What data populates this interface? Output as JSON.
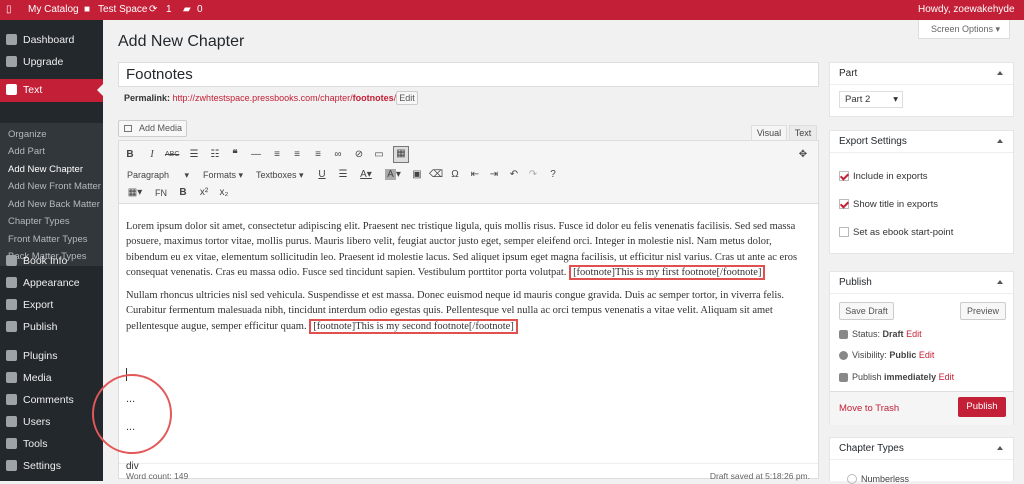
{
  "adminbar": {
    "catalog": "My Catalog",
    "site": "Test Space",
    "updates": "1",
    "comments": "0",
    "howdy": "Howdy, zoewakehyde"
  },
  "sidebar": {
    "items": [
      {
        "label": "Dashboard"
      },
      {
        "label": "Upgrade"
      },
      {
        "label": "Text"
      },
      {
        "label": "Book Info"
      },
      {
        "label": "Appearance"
      },
      {
        "label": "Export"
      },
      {
        "label": "Publish"
      },
      {
        "label": "Plugins"
      },
      {
        "label": "Media"
      },
      {
        "label": "Comments"
      },
      {
        "label": "Users"
      },
      {
        "label": "Tools"
      },
      {
        "label": "Settings"
      }
    ],
    "sub": [
      "Organize",
      "Add Part",
      "Add New Chapter",
      "Add New Front Matter",
      "Add New Back Matter",
      "Chapter Types",
      "Front Matter Types",
      "Back Matter Types"
    ]
  },
  "page": {
    "title": "Add New Chapter",
    "screen_options": "Screen Options ▾"
  },
  "post": {
    "title": "Footnotes",
    "permalink_label": "Permalink:",
    "permalink_base": "http://zwhtestspace.pressbooks.com/chapter/",
    "permalink_slug": "footnotes",
    "permalink_end": "/",
    "edit": "Edit"
  },
  "editor": {
    "add_media": "Add Media",
    "tab_visual": "Visual",
    "tab_text": "Text",
    "paragraph": "Paragraph",
    "formats": "Formats",
    "textboxes": "Textboxes",
    "fn": "FN",
    "p1": "Lorem ipsum dolor sit amet, consectetur adipiscing elit. Praesent nec tristique ligula, quis mollis risus. Fusce id dolor eu felis venenatis facilisis. Sed sed massa posuere, maximus tortor vitae, mollis purus. Mauris libero velit, feugiat auctor justo eget, semper eleifend orci. Integer in molestie nisl. Nam metus dolor, bibendum eu ex vitae, elementum sollicitudin leo. Praesent id molestie lacus. Sed aliquet ipsum eget magna facilisis, ut efficitur nisl varius. Cras ut ante ac eros consequat venenatis. Cras eu massa odio. Fusce sed tincidunt sapien. Vestibulum porttitor porta volutpat.",
    "fn1": "[footnote]This is my first footnote[/footnote]",
    "p2": "Nullam rhoncus ultricies nisl sed vehicula. Suspendisse et est massa. Donec euismod neque id mauris congue gravida. Duis ac semper tortor, in viverra felis. Curabitur fermentum malesuada nibh, tincidunt interdum odio egestas quis. Pellentesque vel nulla ac orci tempus venenatis a vitae velit. Aliquam sit amet pellentesque augue, semper efficitur quam.",
    "fn2": "[footnote]This is my second footnote[/footnote]",
    "dots": "...",
    "path": "div",
    "word_count": "Word count: 149",
    "draft_saved": "Draft saved at 5:18:26 pm."
  },
  "part": {
    "title": "Part",
    "value": "Part 2"
  },
  "export": {
    "title": "Export Settings",
    "include": "Include in exports",
    "show_title": "Show title in exports",
    "start_point": "Set as ebook start-point"
  },
  "publish": {
    "title": "Publish",
    "save_draft": "Save Draft",
    "preview": "Preview",
    "status_label": "Status:",
    "status": "Draft",
    "visibility_label": "Visibility:",
    "visibility": "Public",
    "publish_label": "Publish",
    "publish_when": "immediately",
    "edit": "Edit",
    "trash": "Move to Trash",
    "publish_btn": "Publish"
  },
  "chapter_types": {
    "title": "Chapter Types",
    "first": "Numberless"
  }
}
